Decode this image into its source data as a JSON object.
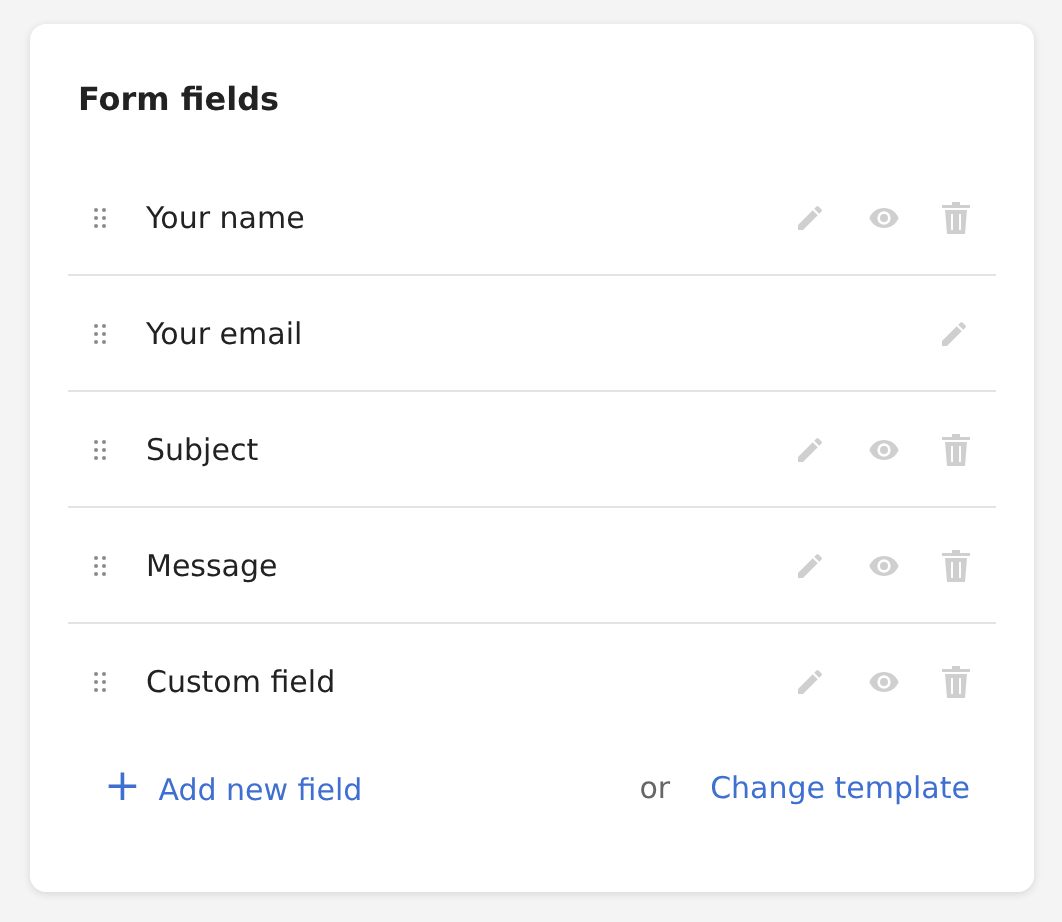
{
  "title": "Form fields",
  "fields": [
    {
      "label": "Your name",
      "kind": "full"
    },
    {
      "label": "Your email",
      "kind": "locked"
    },
    {
      "label": "Subject",
      "kind": "full"
    },
    {
      "label": "Message",
      "kind": "full"
    },
    {
      "label": "Custom field",
      "kind": "full"
    }
  ],
  "footer": {
    "add_link": "Add new field",
    "plus": "+",
    "or": "or",
    "template_link": "Change template"
  }
}
